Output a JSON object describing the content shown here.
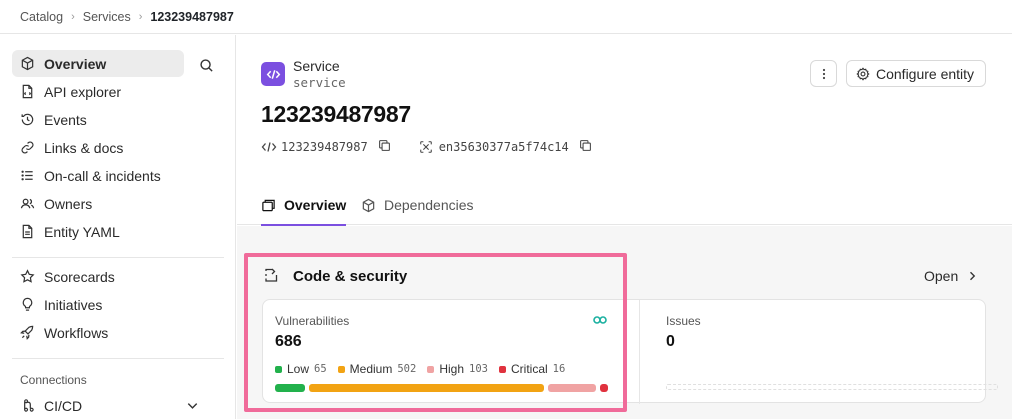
{
  "breadcrumb": {
    "items": [
      "Catalog",
      "Services",
      "123239487987"
    ]
  },
  "sidebar": {
    "items": [
      {
        "label": "Overview",
        "icon": "cube-icon"
      },
      {
        "label": "API explorer",
        "icon": "api-doc-icon"
      },
      {
        "label": "Events",
        "icon": "history-icon"
      },
      {
        "label": "Links & docs",
        "icon": "link-icon"
      },
      {
        "label": "On-call & incidents",
        "icon": "list-icon"
      },
      {
        "label": "Owners",
        "icon": "users-icon"
      },
      {
        "label": "Entity YAML",
        "icon": "file-icon"
      }
    ],
    "secondary_items": [
      {
        "label": "Scorecards",
        "icon": "star-icon"
      },
      {
        "label": "Initiatives",
        "icon": "bulb-icon"
      },
      {
        "label": "Workflows",
        "icon": "rocket-icon"
      }
    ],
    "section_label": "Connections",
    "connection_item": {
      "label": "CI/CD",
      "icon": "cicd-icon"
    }
  },
  "header": {
    "entity_type": "Service",
    "entity_type_key": "service",
    "title": "123239487987",
    "tag": "123239487987",
    "id": "en35630377a5f74c14",
    "configure_label": "Configure entity"
  },
  "tabs": [
    {
      "label": "Overview",
      "active": true
    },
    {
      "label": "Dependencies",
      "active": false
    }
  ],
  "card": {
    "title": "Code & security",
    "open_label": "Open",
    "vulnerabilities": {
      "label": "Vulnerabilities",
      "total": "686",
      "breakdown": [
        {
          "label": "Low",
          "count": "65",
          "color": "#22b14c"
        },
        {
          "label": "Medium",
          "count": "502",
          "color": "#f2a313"
        },
        {
          "label": "High",
          "count": "103",
          "color": "#f0a3a3"
        },
        {
          "label": "Critical",
          "count": "16",
          "color": "#e0323e"
        }
      ]
    },
    "issues": {
      "label": "Issues",
      "total": "0"
    }
  },
  "colors": {
    "accent": "#7b4fe0",
    "highlight": "#f06b9a",
    "link_icon": "#1ab0a0"
  }
}
